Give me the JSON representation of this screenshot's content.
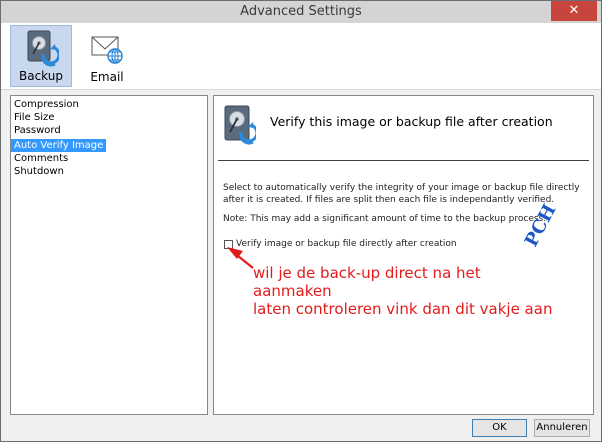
{
  "window": {
    "title": "Advanced Settings",
    "close_glyph": "✕"
  },
  "toolbar": {
    "items": [
      {
        "label": "Backup",
        "icon": "backup-disk-icon",
        "selected": true
      },
      {
        "label": "Email",
        "icon": "email-envelope-icon",
        "selected": false
      }
    ]
  },
  "sidebar": {
    "items": [
      {
        "label": "Compression"
      },
      {
        "label": "File Size"
      },
      {
        "label": "Password"
      },
      {
        "label": "Auto Verify Image",
        "selected": true
      },
      {
        "label": "Comments"
      },
      {
        "label": "Shutdown"
      }
    ]
  },
  "main": {
    "heading": "Verify this image or backup file after creation",
    "description": "Select to automatically verify the integrity of your image or backup file directly after it is created. If files are split then each file is independantly verified.",
    "note": "Note: This may add a significant amount of time to the backup process.",
    "checkbox_label": "Verify image or backup file directly after creation",
    "checkbox_checked": false
  },
  "annotation": {
    "watermark": "PCH",
    "callout_line1": "wil je de back-up direct na het aanmaken",
    "callout_line2": "laten controleren vink dan dit vakje aan"
  },
  "buttons": {
    "ok": "OK",
    "cancel": "Annuleren"
  }
}
